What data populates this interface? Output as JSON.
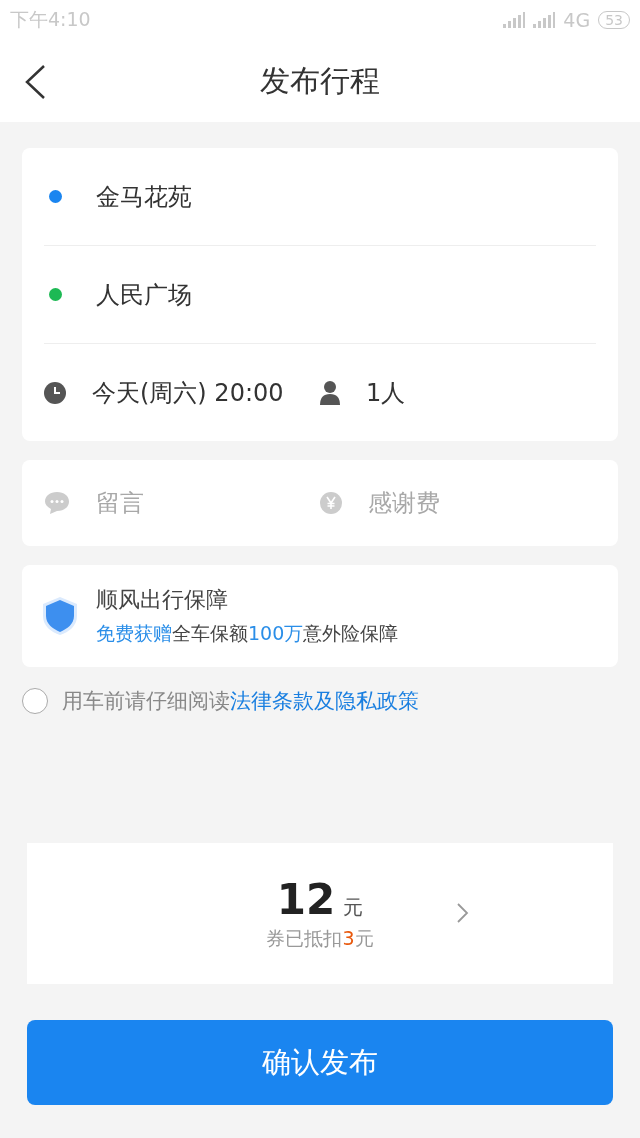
{
  "status_bar": {
    "time": "下午4:10",
    "network": "4G",
    "battery": "53"
  },
  "header": {
    "title": "发布行程"
  },
  "route": {
    "stops": [
      {
        "name": "金马花苑",
        "color": "#1a85f0"
      },
      {
        "name": "人民广场",
        "color": "#1db954"
      }
    ],
    "time": "今天(周六) 20:00",
    "passengers": "1人"
  },
  "extras": {
    "message": {
      "placeholder": "留言"
    },
    "fee": {
      "placeholder": "感谢费"
    }
  },
  "insurance": {
    "title": "顺风出行保障",
    "parts": [
      {
        "text": "免费获赠",
        "highlight": true
      },
      {
        "text": "全车保额",
        "highlight": false
      },
      {
        "text": "100万",
        "highlight": true
      },
      {
        "text": "意外险保障",
        "highlight": false
      }
    ]
  },
  "agreement": {
    "checked": false,
    "text": "用车前请仔细阅读",
    "link": "法律条款及隐私政策"
  },
  "price": {
    "amount": "12",
    "unit": "元",
    "parts": [
      {
        "text": "券已抵扣",
        "highlight": false
      },
      {
        "text": "3",
        "highlight": true
      },
      {
        "text": "元",
        "highlight": false
      }
    ]
  },
  "confirm_button": "确认发布"
}
